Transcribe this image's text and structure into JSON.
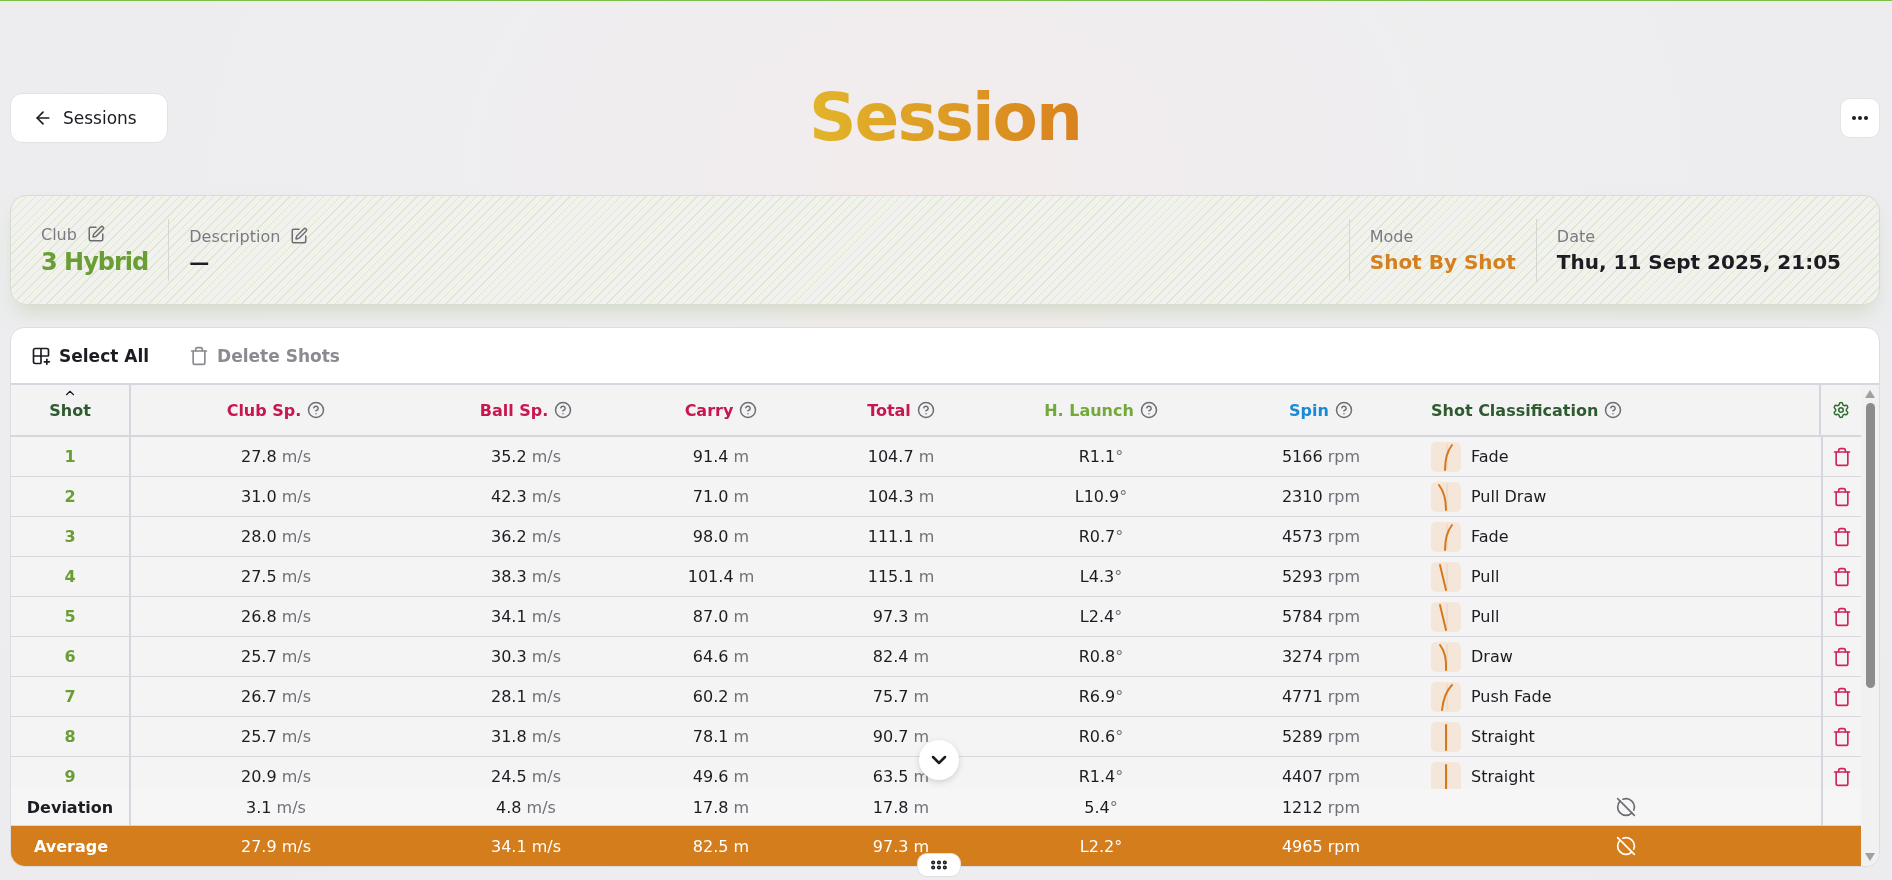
{
  "back_button": {
    "label": "Sessions"
  },
  "title": "Session",
  "info": [
    {
      "label": "Club",
      "value": "3 Hybrid",
      "editable": true,
      "kind": "club"
    },
    {
      "label": "Description",
      "value": "—",
      "editable": true,
      "kind": "description"
    },
    {
      "label": "Mode",
      "value": "Shot By Shot",
      "editable": false,
      "kind": "mode"
    },
    {
      "label": "Date",
      "value": "Thu, 11 Sept 2025, 21:05",
      "editable": false,
      "kind": "date"
    }
  ],
  "toolbar": [
    {
      "label": "Select All",
      "kind": "select",
      "disabled": false
    },
    {
      "label": "Delete Shots",
      "kind": "delete",
      "disabled": true
    }
  ],
  "table": {
    "columns": [
      {
        "label": "Shot",
        "color": "#2f5a2f",
        "sorted": true,
        "help": false
      },
      {
        "label": "Club Sp.",
        "color": "#c8174f",
        "sorted": false,
        "help": true
      },
      {
        "label": "Ball Sp.",
        "color": "#c8174f",
        "sorted": false,
        "help": true
      },
      {
        "label": "Carry",
        "color": "#c8174f",
        "sorted": false,
        "help": true
      },
      {
        "label": "Total",
        "color": "#c8174f",
        "sorted": false,
        "help": true
      },
      {
        "label": "H. Launch",
        "color": "#74a83a",
        "sorted": false,
        "help": true
      },
      {
        "label": "Spin",
        "color": "#1a8ad4",
        "sorted": false,
        "help": true
      },
      {
        "label": "Shot Classification",
        "color": "#2f5a2f",
        "sorted": false,
        "help": true
      }
    ],
    "rows": [
      {
        "shot": "1",
        "club_speed": [
          "27.8",
          "m/s"
        ],
        "ball_speed": [
          "35.2",
          "m/s"
        ],
        "carry": [
          "91.4",
          "m"
        ],
        "total": [
          "104.7",
          "m"
        ],
        "h_launch": [
          "R1.1",
          "°"
        ],
        "spin": [
          "5166",
          "rpm"
        ],
        "classification": {
          "label": "Fade",
          "kind": "fade"
        }
      },
      {
        "shot": "2",
        "club_speed": [
          "31.0",
          "m/s"
        ],
        "ball_speed": [
          "42.3",
          "m/s"
        ],
        "carry": [
          "71.0",
          "m"
        ],
        "total": [
          "104.3",
          "m"
        ],
        "h_launch": [
          "L10.9",
          "°"
        ],
        "spin": [
          "2310",
          "rpm"
        ],
        "classification": {
          "label": "Pull Draw",
          "kind": "pull_draw"
        }
      },
      {
        "shot": "3",
        "club_speed": [
          "28.0",
          "m/s"
        ],
        "ball_speed": [
          "36.2",
          "m/s"
        ],
        "carry": [
          "98.0",
          "m"
        ],
        "total": [
          "111.1",
          "m"
        ],
        "h_launch": [
          "R0.7",
          "°"
        ],
        "spin": [
          "4573",
          "rpm"
        ],
        "classification": {
          "label": "Fade",
          "kind": "fade"
        }
      },
      {
        "shot": "4",
        "club_speed": [
          "27.5",
          "m/s"
        ],
        "ball_speed": [
          "38.3",
          "m/s"
        ],
        "carry": [
          "101.4",
          "m"
        ],
        "total": [
          "115.1",
          "m"
        ],
        "h_launch": [
          "L4.3",
          "°"
        ],
        "spin": [
          "5293",
          "rpm"
        ],
        "classification": {
          "label": "Pull",
          "kind": "pull"
        }
      },
      {
        "shot": "5",
        "club_speed": [
          "26.8",
          "m/s"
        ],
        "ball_speed": [
          "34.1",
          "m/s"
        ],
        "carry": [
          "87.0",
          "m"
        ],
        "total": [
          "97.3",
          "m"
        ],
        "h_launch": [
          "L2.4",
          "°"
        ],
        "spin": [
          "5784",
          "rpm"
        ],
        "classification": {
          "label": "Pull",
          "kind": "pull"
        }
      },
      {
        "shot": "6",
        "club_speed": [
          "25.7",
          "m/s"
        ],
        "ball_speed": [
          "30.3",
          "m/s"
        ],
        "carry": [
          "64.6",
          "m"
        ],
        "total": [
          "82.4",
          "m"
        ],
        "h_launch": [
          "R0.8",
          "°"
        ],
        "spin": [
          "3274",
          "rpm"
        ],
        "classification": {
          "label": "Draw",
          "kind": "draw"
        }
      },
      {
        "shot": "7",
        "club_speed": [
          "26.7",
          "m/s"
        ],
        "ball_speed": [
          "28.1",
          "m/s"
        ],
        "carry": [
          "60.2",
          "m"
        ],
        "total": [
          "75.7",
          "m"
        ],
        "h_launch": [
          "R6.9",
          "°"
        ],
        "spin": [
          "4771",
          "rpm"
        ],
        "classification": {
          "label": "Push Fade",
          "kind": "push_fade"
        }
      },
      {
        "shot": "8",
        "club_speed": [
          "25.7",
          "m/s"
        ],
        "ball_speed": [
          "31.8",
          "m/s"
        ],
        "carry": [
          "78.1",
          "m"
        ],
        "total": [
          "90.7",
          "m"
        ],
        "h_launch": [
          "R0.6",
          "°"
        ],
        "spin": [
          "5289",
          "rpm"
        ],
        "classification": {
          "label": "Straight",
          "kind": "straight"
        }
      },
      {
        "shot": "9",
        "club_speed": [
          "20.9",
          "m/s"
        ],
        "ball_speed": [
          "24.5",
          "m/s"
        ],
        "carry": [
          "49.6",
          "m"
        ],
        "total": [
          "63.5",
          "m"
        ],
        "h_launch": [
          "R1.4",
          "°"
        ],
        "spin": [
          "4407",
          "rpm"
        ],
        "classification": {
          "label": "Straight",
          "kind": "straight"
        }
      }
    ],
    "summary": [
      {
        "label": "Deviation",
        "kind": "deviation",
        "club_speed": [
          "3.1",
          "m/s"
        ],
        "ball_speed": [
          "4.8",
          "m/s"
        ],
        "carry": [
          "17.8",
          "m"
        ],
        "total": [
          "17.8",
          "m"
        ],
        "h_launch": [
          "5.4",
          "°"
        ],
        "spin": [
          "1212",
          "rpm"
        ]
      },
      {
        "label": "Average",
        "kind": "average",
        "club_speed": [
          "27.9",
          "m/s"
        ],
        "ball_speed": [
          "34.1",
          "m/s"
        ],
        "carry": [
          "82.5",
          "m"
        ],
        "total": [
          "97.3",
          "m"
        ],
        "h_launch": [
          "L2.2",
          "°"
        ],
        "spin": [
          "4965",
          "rpm"
        ]
      }
    ]
  }
}
